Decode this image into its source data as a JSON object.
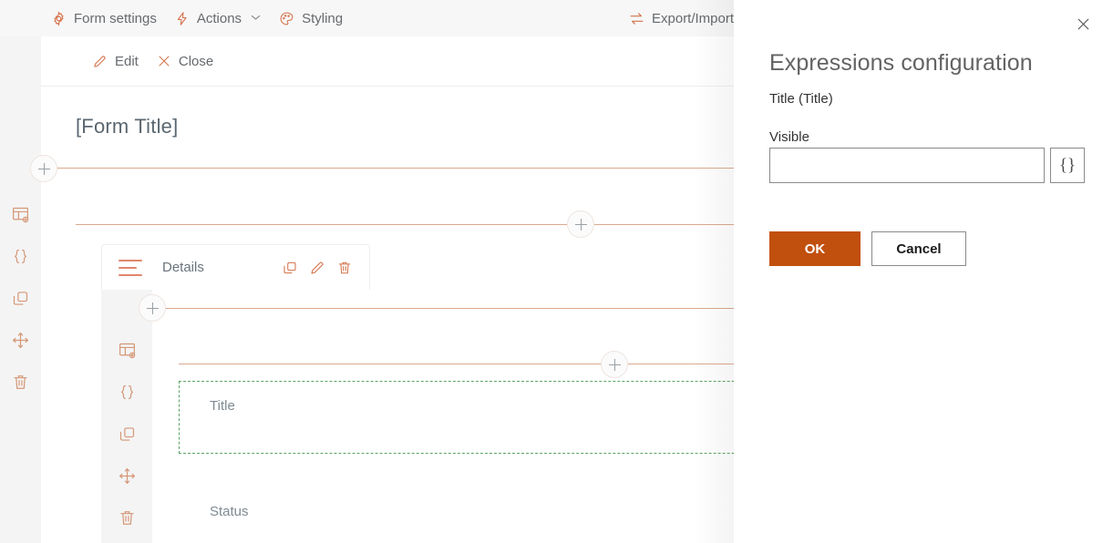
{
  "topbar": {
    "items": [
      {
        "label": "Form settings",
        "icon": "gear-icon",
        "has_chevron": false
      },
      {
        "label": "Actions",
        "icon": "lightning-icon",
        "has_chevron": true
      },
      {
        "label": "Styling",
        "icon": "palette-icon",
        "has_chevron": false
      }
    ],
    "right_items": [
      {
        "label": "Export/Import",
        "icon": "swap-arrows-icon"
      }
    ]
  },
  "editbar": {
    "items": [
      {
        "label": "Edit",
        "icon": "pencil-icon"
      },
      {
        "label": "Close",
        "icon": "close-x-icon"
      }
    ]
  },
  "form": {
    "title": "[Form Title]",
    "section_tab": {
      "label": "Details",
      "actions": [
        {
          "name": "copy-icon"
        },
        {
          "name": "pencil-icon"
        },
        {
          "name": "trash-icon"
        }
      ]
    },
    "fields": [
      {
        "label": "Title",
        "selected": true
      },
      {
        "label": "Status",
        "selected": false
      }
    ]
  },
  "rail": {
    "icons": [
      {
        "name": "layout-settings-icon"
      },
      {
        "name": "braces-icon"
      },
      {
        "name": "copy-icon"
      },
      {
        "name": "move-icon"
      },
      {
        "name": "trash-icon"
      }
    ]
  },
  "inner_rail": {
    "icons": [
      {
        "name": "layout-settings-icon"
      },
      {
        "name": "braces-icon"
      },
      {
        "name": "copy-icon"
      },
      {
        "name": "move-icon"
      },
      {
        "name": "trash-icon"
      }
    ]
  },
  "panel": {
    "title": "Expressions configuration",
    "subtitle": "Title (Title)",
    "field": {
      "label": "Visible",
      "value": "",
      "placeholder": "",
      "expression_button_label": "{}"
    },
    "ok_label": "OK",
    "cancel_label": "Cancel",
    "close_icon": "close-x-icon"
  },
  "colors": {
    "accent_orange": "#c1500e",
    "line_orange": "#dba98e",
    "icon_orange": "#d4714a",
    "selection_green": "#5aa469",
    "rail_gray": "#f4f4f4",
    "topbar_gray": "#f7f7f7",
    "text_gray": "#666a6e"
  }
}
